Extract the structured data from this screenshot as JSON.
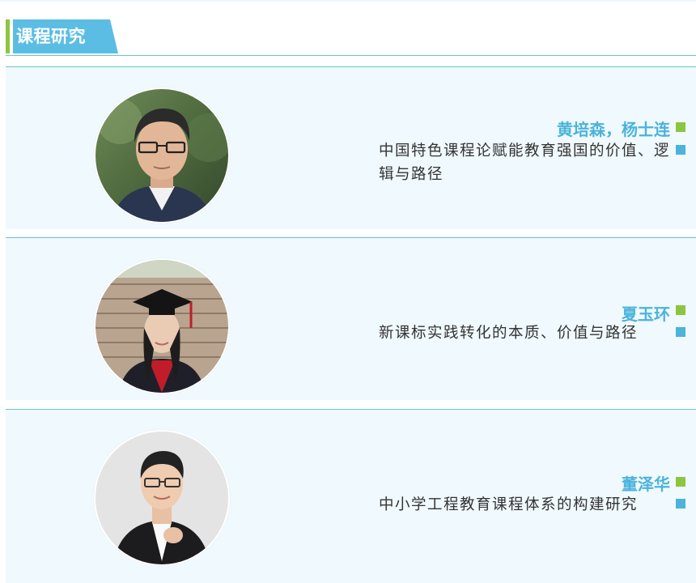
{
  "section": {
    "title": "课程研究"
  },
  "colors": {
    "accent_green": "#8cc63f",
    "accent_blue": "#4bb3dc",
    "card_bg": "#f0f9fd",
    "divider": "#66c6cc"
  },
  "entries": [
    {
      "author": "黄培森，杨士连",
      "title": "中国特色课程论赋能教育强国的价值、逻辑与路径",
      "photo": "portrait-man-glasses"
    },
    {
      "author": "夏玉环",
      "title": "新课标实践转化的本质、价值与路径",
      "photo": "portrait-woman-graduation-cap"
    },
    {
      "author": "董泽华",
      "title": "中小学工程教育课程体系的构建研究",
      "photo": "portrait-man-suit"
    }
  ]
}
